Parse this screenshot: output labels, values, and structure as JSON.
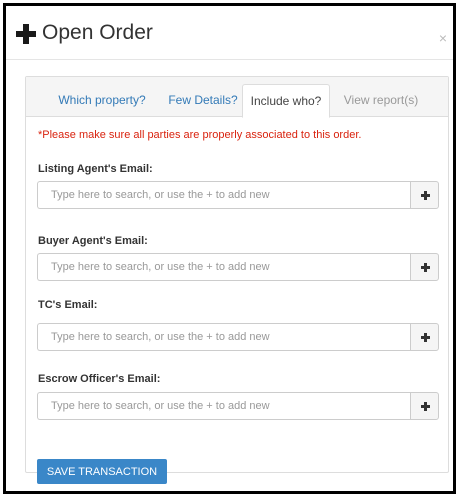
{
  "modal": {
    "title": "Open Order",
    "close_label": "×"
  },
  "tabs": [
    {
      "label": "Which property?",
      "state": "link"
    },
    {
      "label": "Few Details?",
      "state": "link"
    },
    {
      "label": "Include who?",
      "state": "active"
    },
    {
      "label": "View report(s)",
      "state": "disabled"
    }
  ],
  "notice": "*Please make sure all parties are properly associated to this order.",
  "fields": [
    {
      "label": "Listing Agent's Email:",
      "placeholder": "Type here to search, or use the + to add new"
    },
    {
      "label": "Buyer Agent's Email:",
      "placeholder": "Type here to search, or use the + to add new"
    },
    {
      "label": "TC's Email:",
      "placeholder": "Type here to search, or use the + to add new"
    },
    {
      "label": "Escrow Officer's Email:",
      "placeholder": "Type here to search, or use the + to add new"
    }
  ],
  "actions": {
    "save_label": "SAVE TRANSACTION"
  },
  "icons": {
    "header": "plus-icon",
    "add": "plus-icon",
    "close": "close-icon"
  },
  "colors": {
    "link": "#337ab7",
    "notice": "#d9230f",
    "primary_button": "#3a87c8",
    "disabled_tab": "#999999"
  }
}
